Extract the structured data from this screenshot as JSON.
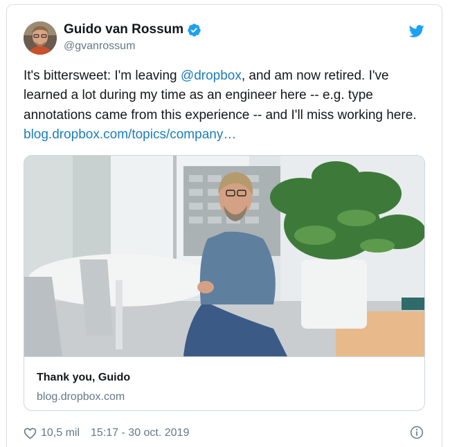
{
  "tweet": {
    "author_name": "Guido van Rossum",
    "author_handle": "@gvanrossum",
    "text_parts": {
      "p1": "It's bittersweet: I'm leaving ",
      "mention": "@dropbox",
      "p2": ", and am now retired. I've learned a lot during my time as an engineer here -- e.g. type annotations came from this experience -- and I'll miss working here. ",
      "link": "blog.dropbox.com/topics/company…"
    },
    "verified": true,
    "icons": [
      "verified-badge-icon",
      "twitter-bird-icon",
      "heart-icon",
      "info-icon"
    ]
  },
  "link_card": {
    "title": "Thank you, Guido",
    "domain": "blog.dropbox.com"
  },
  "footer": {
    "likes": "10,5 mil",
    "timestamp": "15:17 - 30 oct. 2019"
  },
  "colors": {
    "link": "#1b7cbf",
    "verified": "#1da1f2",
    "twitter": "#1da1f2",
    "secondary_text": "#657786"
  }
}
